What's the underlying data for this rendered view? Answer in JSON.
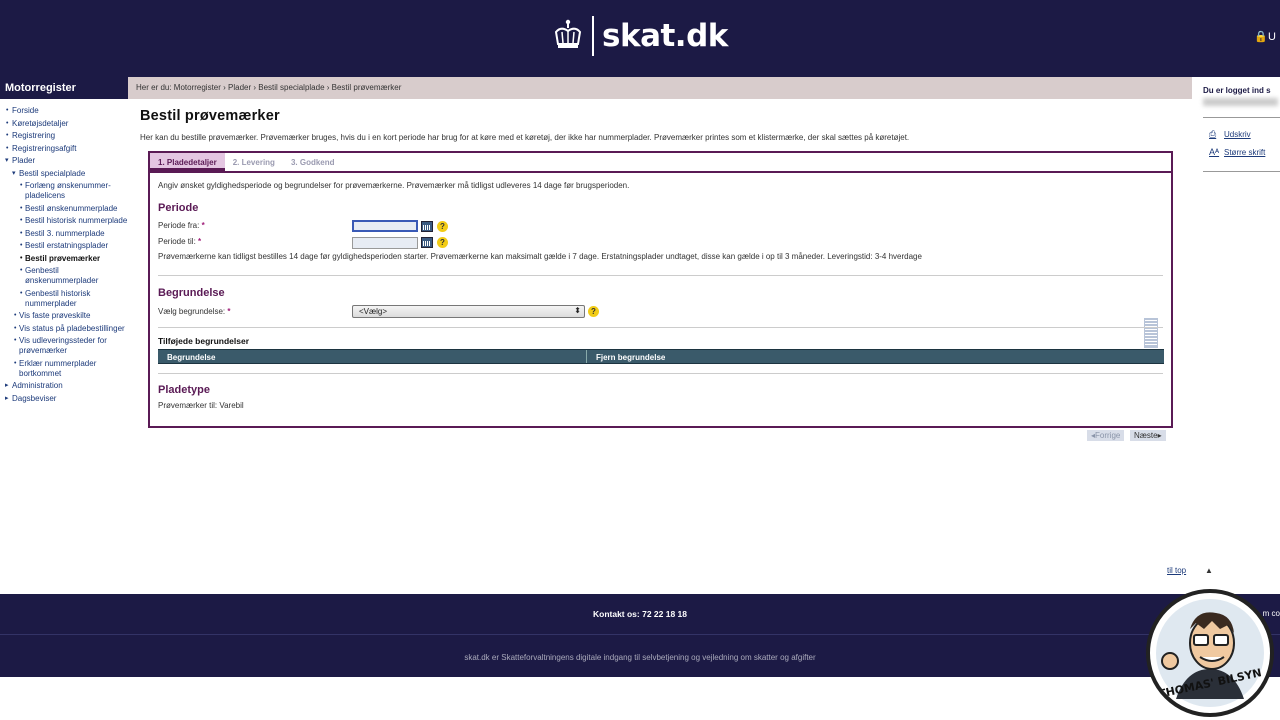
{
  "header": {
    "brand": "skat.dk",
    "user_link_fragment": "U"
  },
  "nav": {
    "title": "Motorregister",
    "items": [
      {
        "label": "Forside",
        "level": 0
      },
      {
        "label": "Køretøjsdetaljer",
        "level": 0
      },
      {
        "label": "Registrering",
        "level": 0
      },
      {
        "label": "Registreringsafgift",
        "level": 0
      },
      {
        "label": "Plader",
        "level": 0
      },
      {
        "label": "Bestil specialplade",
        "level": 1
      },
      {
        "label": "Forlæng ønskenummer-pladelicens",
        "level": 2
      },
      {
        "label": "Bestil ønskenummerplade",
        "level": 2
      },
      {
        "label": "Bestil historisk nummerplade",
        "level": 2
      },
      {
        "label": "Bestil 3. nummerplade",
        "level": 2
      },
      {
        "label": "Bestil erstatningsplader",
        "level": 2
      },
      {
        "label": "Bestil prøvemærker",
        "level": 2
      },
      {
        "label": "Genbestil ønskenummerplader",
        "level": 2
      },
      {
        "label": "Genbestil historisk nummerplader",
        "level": 2
      },
      {
        "label": "Vis faste prøveskilte",
        "level": 1
      },
      {
        "label": "Vis status på pladebestillinger",
        "level": 1
      },
      {
        "label": "Vis udleveringssteder for prøvemærker",
        "level": 1
      },
      {
        "label": "Erklær nummerplader bortkommet",
        "level": 1
      },
      {
        "label": "Administration",
        "level": 0
      },
      {
        "label": "Dagsbeviser",
        "level": 0
      }
    ]
  },
  "breadcrumb": "Her er du: Motorregister › Plader › Bestil specialplade › Bestil prøvemærker",
  "right_panel": {
    "logged_in": "Du er logget ind s",
    "print": "Udskriv",
    "larger_font": "Større skrift"
  },
  "main": {
    "title": "Bestil prøvemærker",
    "intro": "Her kan du bestille prøvemærker. Prøvemærker bruges, hvis du i en kort periode har brug for at køre med et køretøj, der ikke har nummerplader. Prøvemærker printes som et klistermærke, der skal sættes på køretøjet.",
    "tabs": [
      "1. Pladedetaljer",
      "2. Levering",
      "3. Godkend"
    ],
    "instruction": "Angiv ønsket gyldighedsperiode og begrundelser for prøvemærkerne. Prøvemærker må tidligst udleveres 14 dage før brugsperioden.",
    "periode": {
      "heading": "Periode",
      "from_label": "Periode fra:",
      "to_label": "Periode til:",
      "from_value": "",
      "to_value": "",
      "note": "Prøvemærkerne kan tidligst bestilles 14 dage før gyldighedsperioden starter. Prøvemærkerne kan maksimalt gælde i 7 dage. Erstatningsplader undtaget, disse kan gælde i op til 3 måneder. Leveringstid: 3-4 hverdage"
    },
    "begrundelse": {
      "heading": "Begrundelse",
      "select_label": "Vælg begrundelse:",
      "select_value": "<Vælg>",
      "added_heading": "Tilføjede begrundelser",
      "columns": [
        "Begrundelse",
        "Fjern begrundelse"
      ]
    },
    "pladetype": {
      "heading": "Pladetype",
      "text": "Prøvemærker til: Varebil"
    },
    "pager": {
      "prev": "Forrige",
      "next": "Næste"
    },
    "to_top": "til top"
  },
  "footer": {
    "contact": "Kontakt os: 72 22 18 18",
    "right_fragment": "m co",
    "note": "skat.dk er Skatteforvaltningens digitale indgang til selvbetjening og vejledning om skatter og afgifter"
  },
  "badge": {
    "text": "THOMAS' BILSYN"
  },
  "colors": {
    "navy": "#1c1a45",
    "purple": "#5a1a55",
    "accent_pink": "#e4c6e2",
    "help_yellow": "#f2cc16"
  }
}
